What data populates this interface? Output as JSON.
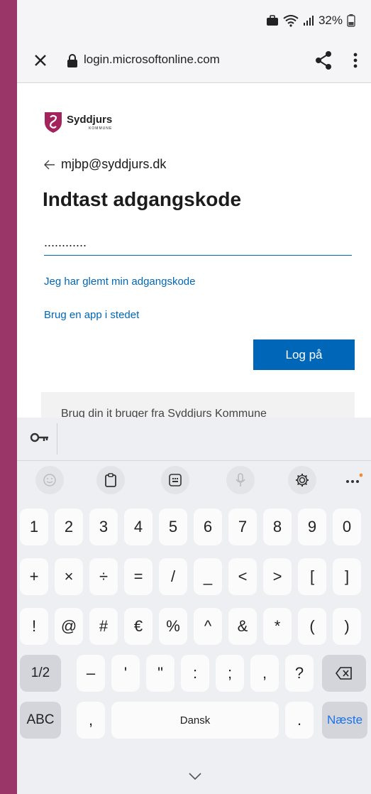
{
  "status_bar": {
    "battery_text": "32%"
  },
  "browser": {
    "url": "login.microsoftonline.com"
  },
  "login": {
    "brand_name": "Syddjurs",
    "brand_sub": "KOMMUNE",
    "account": "mjbp@syddjurs.dk",
    "heading": "Indtast adgangskode",
    "password_value": "............",
    "forgot_link": "Jeg har glemt min adgangskode",
    "app_link": "Brug en app i stedet",
    "signin_button": "Log på",
    "info_text": "Brug din it bruger fra Syddjurs Kommune"
  },
  "keyboard": {
    "row1": [
      "1",
      "2",
      "3",
      "4",
      "5",
      "6",
      "7",
      "8",
      "9",
      "0"
    ],
    "row2": [
      "+",
      "×",
      "÷",
      "=",
      "/",
      "_",
      "<",
      ">",
      "[",
      "]"
    ],
    "row3": [
      "!",
      "@",
      "#",
      "€",
      "%",
      "^",
      "&",
      "*",
      "(",
      ")"
    ],
    "row4": {
      "page": "1/2",
      "keys": [
        "–",
        "'",
        "\"",
        ":",
        ";",
        ","
      ],
      "question": "?"
    },
    "row5": {
      "abc": "ABC",
      "comma": ",",
      "space": "Dansk",
      "period": ".",
      "next": "Næste"
    },
    "accent_color": "#1a73e8",
    "brand_color": "#0067b8"
  }
}
